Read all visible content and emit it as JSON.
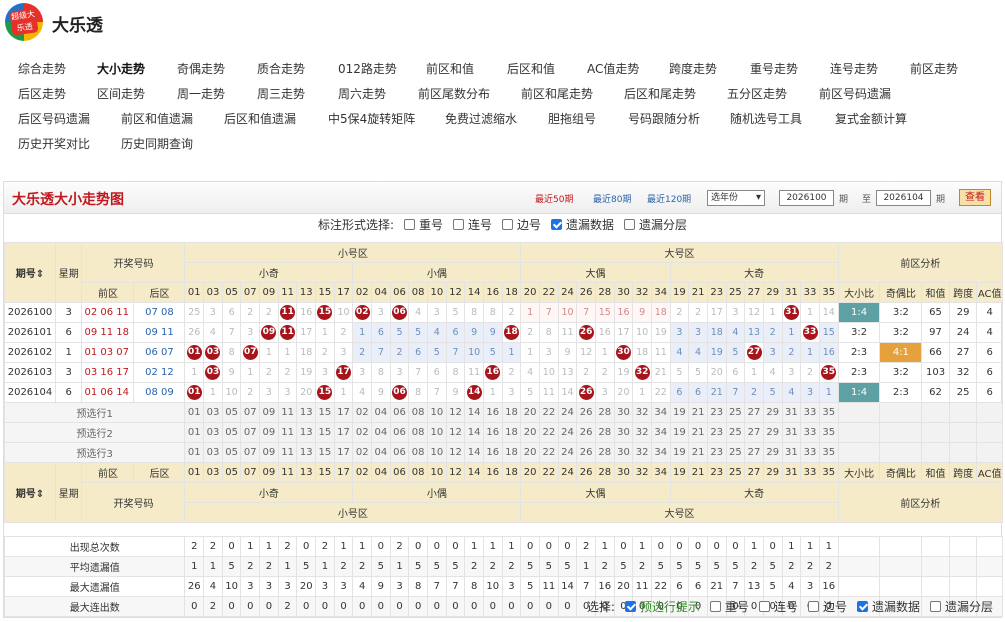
{
  "site": {
    "logo_text": "超级大乐透",
    "name": "大乐透"
  },
  "nav": [
    [
      "综合走势",
      "大小走势",
      "奇偶走势",
      "质合走势",
      "012路走势",
      "前区和值",
      "后区和值",
      "AC值走势",
      "跨度走势",
      "重号走势",
      "连号走势",
      "前区走势"
    ],
    [
      "后区走势",
      "区间走势",
      "周一走势",
      "周三走势",
      "周六走势",
      "前区尾数分布",
      "前区和尾走势",
      "后区和尾走势",
      "五分区走势",
      "前区号码遗漏"
    ],
    [
      "后区号码遗漏",
      "前区和值遗漏",
      "后区和值遗漏",
      "中5保4旋转矩阵",
      "免费过滤缩水",
      "胆拖组号",
      "号码跟随分析",
      "随机选号工具",
      "复式金额计算"
    ],
    [
      "历史开奖对比",
      "历史同期查询"
    ]
  ],
  "panel": {
    "title": "大乐透大小走势图",
    "recent50": "最近50期",
    "recent80": "最近80期",
    "recent120": "最近120期",
    "year_select": "选年份",
    "from_value": "2026100",
    "from_label": "期",
    "to_label": "至",
    "to_value": "2026104",
    "to_suffix": "期",
    "query_button": "查看"
  },
  "options": {
    "label": "标注形式选择:",
    "items": [
      {
        "label": "重号",
        "checked": false
      },
      {
        "label": "连号",
        "checked": false
      },
      {
        "label": "边号",
        "checked": false
      },
      {
        "label": "遗漏数据",
        "checked": true
      },
      {
        "label": "遗漏分层",
        "checked": false
      }
    ]
  },
  "headers": {
    "period": "期号",
    "weekday": "星期",
    "draw": "开奖号码",
    "front": "前区",
    "back": "后区",
    "small_zone": "小号区",
    "big_zone": "大号区",
    "small_odd": "小奇",
    "small_even": "小偶",
    "big_even": "大偶",
    "big_odd": "大奇",
    "front_analysis": "前区分析",
    "analysis_cols": [
      "大小比",
      "奇偶比",
      "和值",
      "跨度",
      "AC值"
    ]
  },
  "numbers": [
    "01",
    "03",
    "05",
    "07",
    "09",
    "11",
    "13",
    "15",
    "17",
    "02",
    "04",
    "06",
    "08",
    "10",
    "12",
    "14",
    "16",
    "18",
    "20",
    "22",
    "24",
    "26",
    "28",
    "30",
    "32",
    "34",
    "19",
    "21",
    "23",
    "25",
    "27",
    "29",
    "31",
    "33",
    "35"
  ],
  "draws": [
    {
      "period": "2026100",
      "weekday": "3",
      "front": "02 06 11 15 31",
      "back": "07 08",
      "cells": [
        "25",
        "3",
        "6",
        "2",
        "2",
        "●",
        "16",
        "●",
        "10",
        "●",
        "3",
        "●",
        "4",
        "3",
        "5",
        "8",
        "8",
        "2",
        "1",
        "7",
        "10",
        "7",
        "15",
        "16",
        "9",
        "18",
        "2",
        "2",
        "17",
        "3",
        "12",
        "1",
        "●",
        "1",
        "14"
      ],
      "hl": "p",
      "bs": "1:4",
      "oe": "3:2",
      "sum": "65",
      "span": "29",
      "ac": "4",
      "bsTag": "b",
      "oeTag": ""
    },
    {
      "period": "2026101",
      "weekday": "6",
      "front": "09 11 18 26 33",
      "back": "09 11",
      "cells": [
        "26",
        "4",
        "7",
        "3",
        "●",
        "●",
        "17",
        "1",
        "2",
        "1",
        "6",
        "5",
        "5",
        "4",
        "6",
        "9",
        "9",
        "●",
        "2",
        "8",
        "11",
        "●",
        "16",
        "17",
        "10",
        "19",
        "3",
        "3",
        "18",
        "4",
        "13",
        "2",
        "1",
        "●",
        "15"
      ],
      "hl": "b",
      "bs": "3:2",
      "oe": "3:2",
      "sum": "97",
      "span": "24",
      "ac": "4",
      "bsTag": "",
      "oeTag": ""
    },
    {
      "period": "2026102",
      "weekday": "1",
      "front": "01 03 07 27 28",
      "back": "06 07",
      "cells": [
        "●",
        "●",
        "8",
        "●",
        "1",
        "1",
        "18",
        "2",
        "3",
        "2",
        "7",
        "2",
        "6",
        "5",
        "7",
        "10",
        "5",
        "1",
        "1",
        "3",
        "9",
        "12",
        "1",
        "●",
        "18",
        "11",
        "4",
        "4",
        "19",
        "5",
        "●",
        "3",
        "2",
        "1",
        "16"
      ],
      "hl": "b2",
      "bs": "2:3",
      "oe": "4:1",
      "sum": "66",
      "span": "27",
      "ac": "6",
      "bsTag": "",
      "oeTag": "o"
    },
    {
      "period": "2026103",
      "weekday": "3",
      "front": "03 16 17 32 35",
      "back": "02 12",
      "cells": [
        "1",
        "●",
        "9",
        "1",
        "2",
        "2",
        "19",
        "3",
        "●",
        "3",
        "8",
        "3",
        "7",
        "6",
        "8",
        "11",
        "●",
        "2",
        "4",
        "10",
        "13",
        "2",
        "2",
        "19",
        "●",
        "21",
        "5",
        "5",
        "20",
        "6",
        "1",
        "4",
        "3",
        "2",
        "●"
      ],
      "hl": "",
      "bs": "2:3",
      "oe": "3:2",
      "sum": "103",
      "span": "32",
      "ac": "6",
      "bsTag": "",
      "oeTag": ""
    },
    {
      "period": "2026104",
      "weekday": "6",
      "front": "01 06 14 15 26",
      "back": "08 09",
      "cells": [
        "●",
        "1",
        "10",
        "2",
        "3",
        "3",
        "20",
        "●",
        "1",
        "4",
        "9",
        "●",
        "8",
        "7",
        "9",
        "●",
        "1",
        "3",
        "5",
        "11",
        "14",
        "●",
        "3",
        "20",
        "1",
        "22",
        "6",
        "6",
        "21",
        "7",
        "2",
        "5",
        "4",
        "3",
        "1"
      ],
      "hl": "b3",
      "bs": "1:4",
      "oe": "2:3",
      "sum": "62",
      "span": "25",
      "ac": "6",
      "bsTag": "b",
      "oeTag": ""
    }
  ],
  "preselect": [
    "预选行1",
    "预选行2",
    "预选行3"
  ],
  "stats": [
    {
      "label": "出现总次数",
      "values": [
        "2",
        "2",
        "0",
        "1",
        "1",
        "2",
        "0",
        "2",
        "1",
        "1",
        "0",
        "2",
        "0",
        "0",
        "0",
        "1",
        "1",
        "1",
        "0",
        "0",
        "0",
        "2",
        "1",
        "0",
        "1",
        "0",
        "0",
        "0",
        "0",
        "0",
        "1",
        "0",
        "1",
        "1",
        "1"
      ]
    },
    {
      "label": "平均遗漏值",
      "values": [
        "1",
        "1",
        "5",
        "2",
        "2",
        "1",
        "5",
        "1",
        "2",
        "2",
        "5",
        "1",
        "5",
        "5",
        "5",
        "2",
        "2",
        "2",
        "5",
        "5",
        "5",
        "1",
        "2",
        "5",
        "2",
        "5",
        "5",
        "5",
        "5",
        "5",
        "2",
        "5",
        "2",
        "2",
        "2"
      ]
    },
    {
      "label": "最大遗漏值",
      "values": [
        "26",
        "4",
        "10",
        "3",
        "3",
        "3",
        "20",
        "3",
        "3",
        "4",
        "9",
        "3",
        "8",
        "7",
        "7",
        "8",
        "10",
        "3",
        "5",
        "11",
        "14",
        "7",
        "16",
        "20",
        "11",
        "22",
        "6",
        "6",
        "21",
        "7",
        "13",
        "5",
        "4",
        "3",
        "16"
      ]
    },
    {
      "label": "最大连出数",
      "values": [
        "0",
        "2",
        "0",
        "0",
        "0",
        "2",
        "0",
        "0",
        "0",
        "0",
        "0",
        "0",
        "0",
        "0",
        "0",
        "0",
        "0",
        "0",
        "0",
        "0",
        "0",
        "0",
        "0",
        "0",
        "0",
        "0",
        "0",
        "0",
        "0",
        "0",
        "0",
        "0",
        "0",
        "0",
        "0"
      ]
    }
  ],
  "footer": {
    "label": "选择:",
    "items": [
      {
        "label": "预选行提示",
        "checked": true,
        "green": true
      },
      {
        "label": "重号",
        "checked": false
      },
      {
        "label": "连号",
        "checked": false
      },
      {
        "label": "边号",
        "checked": false
      },
      {
        "label": "遗漏数据",
        "checked": true
      },
      {
        "label": "遗漏分层",
        "checked": false
      }
    ]
  }
}
